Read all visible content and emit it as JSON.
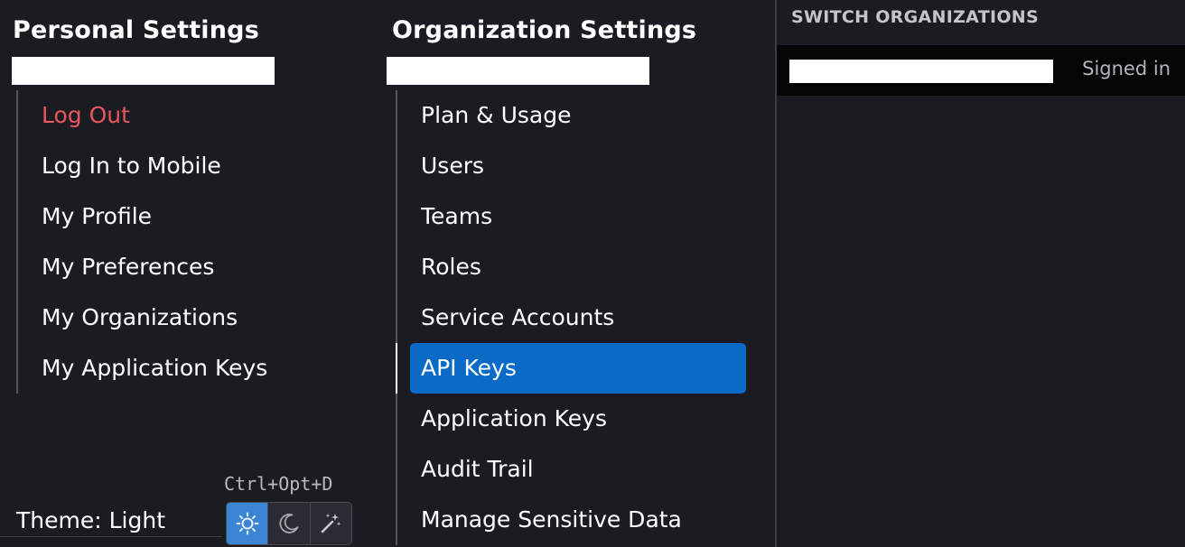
{
  "personal": {
    "title": "Personal Settings",
    "items": [
      {
        "label": "Log Out"
      },
      {
        "label": "Log In to Mobile"
      },
      {
        "label": "My Profile"
      },
      {
        "label": "My Preferences"
      },
      {
        "label": "My Organizations"
      },
      {
        "label": "My Application Keys"
      }
    ],
    "theme_label": "Theme: Light",
    "theme_shortcut": "Ctrl+Opt+D",
    "theme_options": [
      "sun-icon",
      "moon-icon",
      "magic-wand-icon"
    ]
  },
  "organization": {
    "title": "Organization Settings",
    "items": [
      {
        "label": "Plan & Usage"
      },
      {
        "label": "Users"
      },
      {
        "label": "Teams"
      },
      {
        "label": "Roles"
      },
      {
        "label": "Service Accounts"
      },
      {
        "label": "API Keys"
      },
      {
        "label": "Application Keys"
      },
      {
        "label": "Audit Trail"
      },
      {
        "label": "Manage Sensitive Data"
      }
    ],
    "active_item": "API Keys"
  },
  "switch": {
    "title": "SWITCH ORGANIZATIONS",
    "current_status": "Signed in"
  },
  "colors": {
    "background": "#1b1c22",
    "danger": "#e8555e",
    "accent": "#0a6bc6",
    "theme_selected": "#3a86d4"
  }
}
